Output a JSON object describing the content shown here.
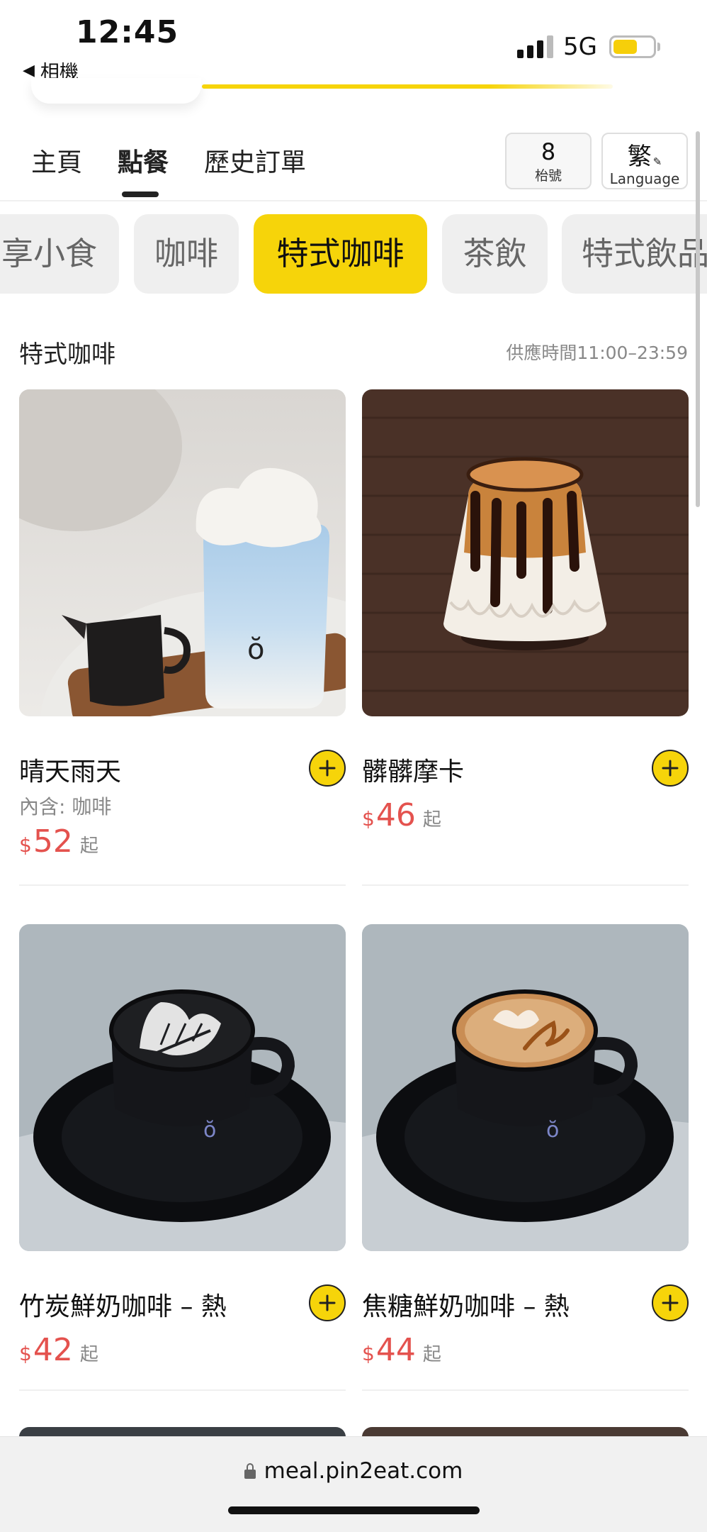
{
  "status_bar": {
    "time": "12:45",
    "back_app": "相機",
    "network": "5G",
    "battery_color": "#f6cf0a"
  },
  "nav": {
    "tabs": [
      {
        "label": "主頁",
        "active": false
      },
      {
        "label": "點餐",
        "active": true
      },
      {
        "label": "歷史訂單",
        "active": false
      }
    ],
    "table_number": "8",
    "table_label": "枱號",
    "language_char": "繁",
    "language_label": "Language"
  },
  "categories": [
    {
      "label": "享小食",
      "active": false
    },
    {
      "label": "咖啡",
      "active": false
    },
    {
      "label": "特式咖啡",
      "active": true
    },
    {
      "label": "茶飲",
      "active": false
    },
    {
      "label": "特式飲品",
      "active": false
    }
  ],
  "section": {
    "title": "特式咖啡",
    "hours": "供應時間11:00–23:59"
  },
  "products": [
    {
      "name": "晴天雨天",
      "sub": "內含: 咖啡",
      "currency": "$",
      "price": "52",
      "suffix": "起"
    },
    {
      "name": "髒髒摩卡",
      "currency": "$",
      "price": "46",
      "suffix": "起"
    },
    {
      "name": "竹炭鮮奶咖啡 – 熱",
      "currency": "$",
      "price": "42",
      "suffix": "起"
    },
    {
      "name": "焦糖鮮奶咖啡 – 熱",
      "currency": "$",
      "price": "44",
      "suffix": "起"
    }
  ],
  "url_bar": {
    "url": "meal.pin2eat.com"
  },
  "colors": {
    "accent": "#f6d40a",
    "price": "#e4524e"
  }
}
